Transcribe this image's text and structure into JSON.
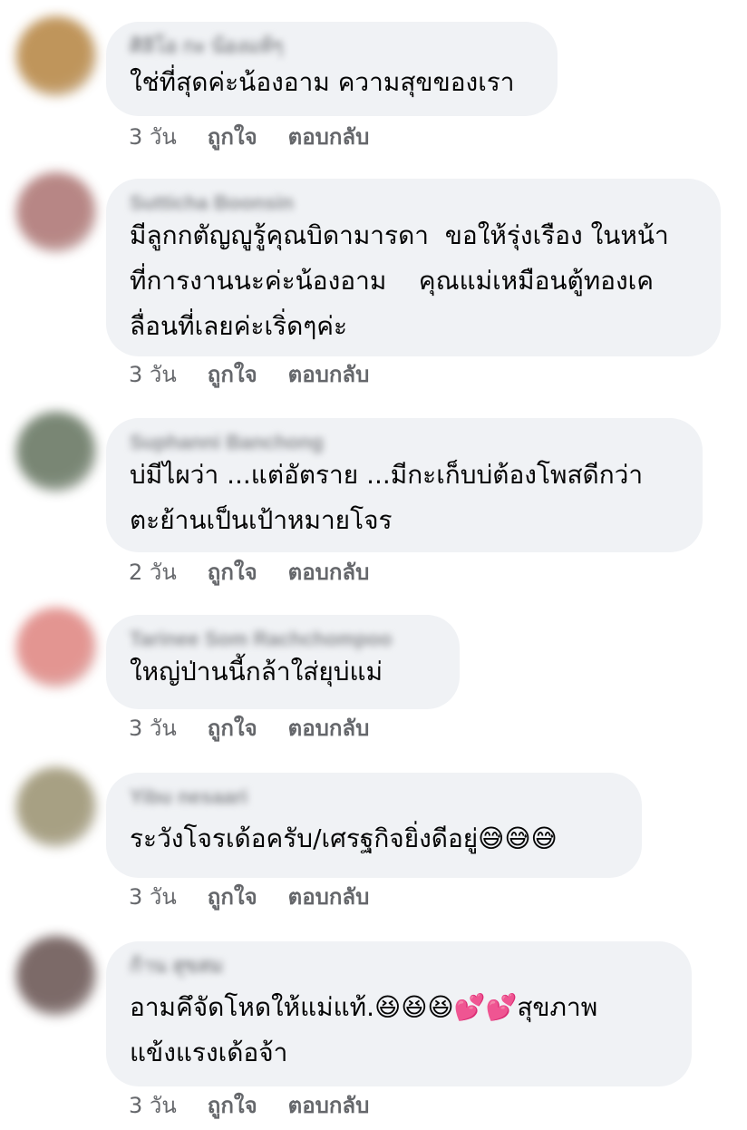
{
  "comments": [
    {
      "author": "ศิลิโอ กะ น้องแท้ๆ",
      "text": "ใช่ที่สุดค่ะน้องอาม ความสุขของเรา",
      "time": "3 วัน",
      "like_label": "ถูกใจ",
      "reply_label": "ตอบกลับ",
      "avatar_color": "#b98a4a"
    },
    {
      "author": "Sutticha Boonsin",
      "text": "มีลูกกตัญญูรู้คุณบิดามารดา  ขอให้รุ่งเรือง ในหน้า\nที่การงานนะค่ะน้องอาม    คุณแม่เหมือนตู้ทองเค\nลื่อนที่เลยค่ะเริ่ดๆค่ะ",
      "time": "3 วัน",
      "like_label": "ถูกใจ",
      "reply_label": "ตอบกลับ",
      "avatar_color": "#b07a78"
    },
    {
      "author": "Suphanni Banchong",
      "text": "บ่มีไผว่า ...แต่อัตราย ...มีกะเก็บบ่ต้องโพสดีกว่า\nตะย้านเป็นเป้าหมายโจร",
      "time": "2 วัน",
      "like_label": "ถูกใจ",
      "reply_label": "ตอบกลับ",
      "avatar_color": "#6b7a66"
    },
    {
      "author": "Tarinee Som Rachchompoo",
      "text": "ใหญ่ป่านนี้กล้าใส่ยุบ่แม่",
      "time": "3 วัน",
      "like_label": "ถูกใจ",
      "reply_label": "ตอบกลับ",
      "avatar_color": "#e08a86"
    },
    {
      "author": "Yibu nesaari",
      "text": "ระวังโจรเด้อครับ/เศรฐกิจยิ่งดีอยู่😅😅😅",
      "time": "3 วัน",
      "like_label": "ถูกใจ",
      "reply_label": "ตอบกลับ",
      "avatar_color": "#9e9676"
    },
    {
      "author": "ก้าน สุขสม",
      "text": "อามคึจัดโหดให้แม่แท้.😆😆😆💕💕สุขภาพ\nแข้งแรงเด้อจ้า",
      "time": "3 วัน",
      "like_label": "ถูกใจ",
      "reply_label": "ตอบกลับ",
      "avatar_color": "#6e5a58"
    }
  ]
}
